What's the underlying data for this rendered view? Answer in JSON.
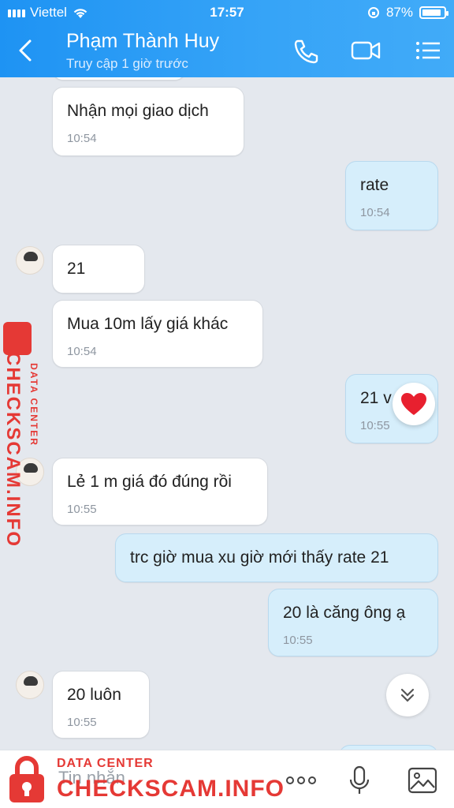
{
  "status": {
    "carrier": "Viettel",
    "time": "17:57",
    "battery": "87%",
    "battery_level": 0.87
  },
  "header": {
    "contact_name": "Phạm Thành Huy",
    "last_seen": "Truy cập 1 giờ trước"
  },
  "messages": [
    {
      "side": "in",
      "text": "Nhận mọi giao dịch",
      "time": "10:54"
    },
    {
      "side": "out",
      "text": "rate",
      "time": "10:54"
    },
    {
      "side": "in",
      "text": "21",
      "time": ""
    },
    {
      "side": "in",
      "text": "Mua 10m lấy giá khác",
      "time": "10:54"
    },
    {
      "side": "out",
      "text": "21 v",
      "time": "10:55"
    },
    {
      "side": "in",
      "text": "Lẻ 1 m giá đó đúng rồi",
      "time": "10:55"
    },
    {
      "side": "out",
      "text": "trc giờ mua xu giờ mới thấy rate 21",
      "time": ""
    },
    {
      "side": "out",
      "text": "20 là căng ông ạ",
      "time": "10:55"
    },
    {
      "side": "in",
      "text": "20 luôn",
      "time": "10:55"
    }
  ],
  "composer": {
    "placeholder": "Tin nhắn"
  },
  "watermark": {
    "brand": "CHECKSCAM.INFO",
    "tagline": "DATA CENTER"
  },
  "colors": {
    "header": "#2b9cf5",
    "incoming_bubble": "#ffffff",
    "outgoing_bubble": "#d6eefb",
    "watermark": "#e53935"
  }
}
